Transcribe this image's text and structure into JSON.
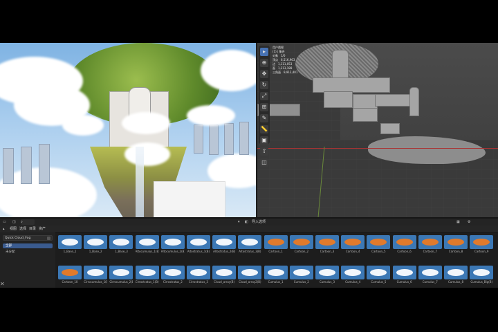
{
  "stats": [
    {
      "k": "对象",
      "v": "1/0"
    },
    {
      "k": "顶点",
      "v": "6,516,963"
    },
    {
      "k": "边",
      "v": "1,111,053"
    },
    {
      "k": "面",
      "v": "1,213,188"
    },
    {
      "k": "三角面",
      "v": "9,912,401"
    }
  ],
  "stats_header": [
    "用户透视",
    "(1) | 集合"
  ],
  "viewport_tools": [
    "select-tool-icon",
    "cursor-tool-icon",
    "move-tool-icon",
    "rotate-tool-icon",
    "scale-tool-icon",
    "transform-tool-icon",
    "annotate-tool-icon",
    "measure-tool-icon",
    "add-cube-tool-icon",
    "extrude-tool-icon",
    "inset-tool-icon"
  ],
  "asset_browser": {
    "header": {
      "search": "",
      "menu": [
        "视图",
        "选择",
        "目录",
        "资产"
      ],
      "import_label": "导入选项"
    },
    "library": "Quick Cloud_Fog",
    "categories": [
      "全部",
      "未分配"
    ],
    "assets": [
      {
        "name": "1_Base_1",
        "kind": "white"
      },
      {
        "name": "1_Base_2",
        "kind": "white"
      },
      {
        "name": "1_Base_3",
        "kind": "white"
      },
      {
        "name": "Altocumulus_1(B)",
        "kind": "white"
      },
      {
        "name": "Altocumulus_2(B)",
        "kind": "white"
      },
      {
        "name": "Altostratus_1(B)",
        "kind": "white"
      },
      {
        "name": "Altostratus_2(B)",
        "kind": "white"
      },
      {
        "name": "Altostratus_3(B)",
        "kind": "white"
      },
      {
        "name": "Cartoon_1",
        "kind": "orange"
      },
      {
        "name": "Cartoon_2",
        "kind": "orange"
      },
      {
        "name": "Cartoon_3",
        "kind": "orange"
      },
      {
        "name": "Cartoon_4",
        "kind": "orange"
      },
      {
        "name": "Cartoon_5",
        "kind": "orange"
      },
      {
        "name": "Cartoon_6",
        "kind": "orange"
      },
      {
        "name": "Cartoon_7",
        "kind": "orange"
      },
      {
        "name": "Cartoon_8",
        "kind": "orange"
      },
      {
        "name": "Cartoon_9",
        "kind": "orange"
      },
      {
        "name": "Cartoon_10",
        "kind": "orange"
      },
      {
        "name": "Cirrocumulus_1(B)",
        "kind": "white"
      },
      {
        "name": "Cirrocumulus_2(B)",
        "kind": "white"
      },
      {
        "name": "Cirrostratus_1(B)",
        "kind": "white"
      },
      {
        "name": "Cirrostratus_2",
        "kind": "white"
      },
      {
        "name": "Cirrostratus_3",
        "kind": "white"
      },
      {
        "name": "Cloud_array(B)",
        "kind": "white"
      },
      {
        "name": "Cloud_array2(B)",
        "kind": "white"
      },
      {
        "name": "Cumulus_1",
        "kind": "white"
      },
      {
        "name": "Cumulus_2",
        "kind": "white"
      },
      {
        "name": "Cumulus_3",
        "kind": "white"
      },
      {
        "name": "Cumulus_4",
        "kind": "white"
      },
      {
        "name": "Cumulus_5",
        "kind": "white"
      },
      {
        "name": "Cumulus_6",
        "kind": "white"
      },
      {
        "name": "Cumulus_7",
        "kind": "white"
      },
      {
        "name": "Cumulus_8",
        "kind": "white"
      },
      {
        "name": "Cumulus_Big(B)",
        "kind": "white"
      }
    ]
  },
  "colors": {
    "thumb_bg": "#3c78b5",
    "orange": "#e07a2c",
    "white": "#f2f6fb",
    "selection": "#3a5b8f"
  }
}
